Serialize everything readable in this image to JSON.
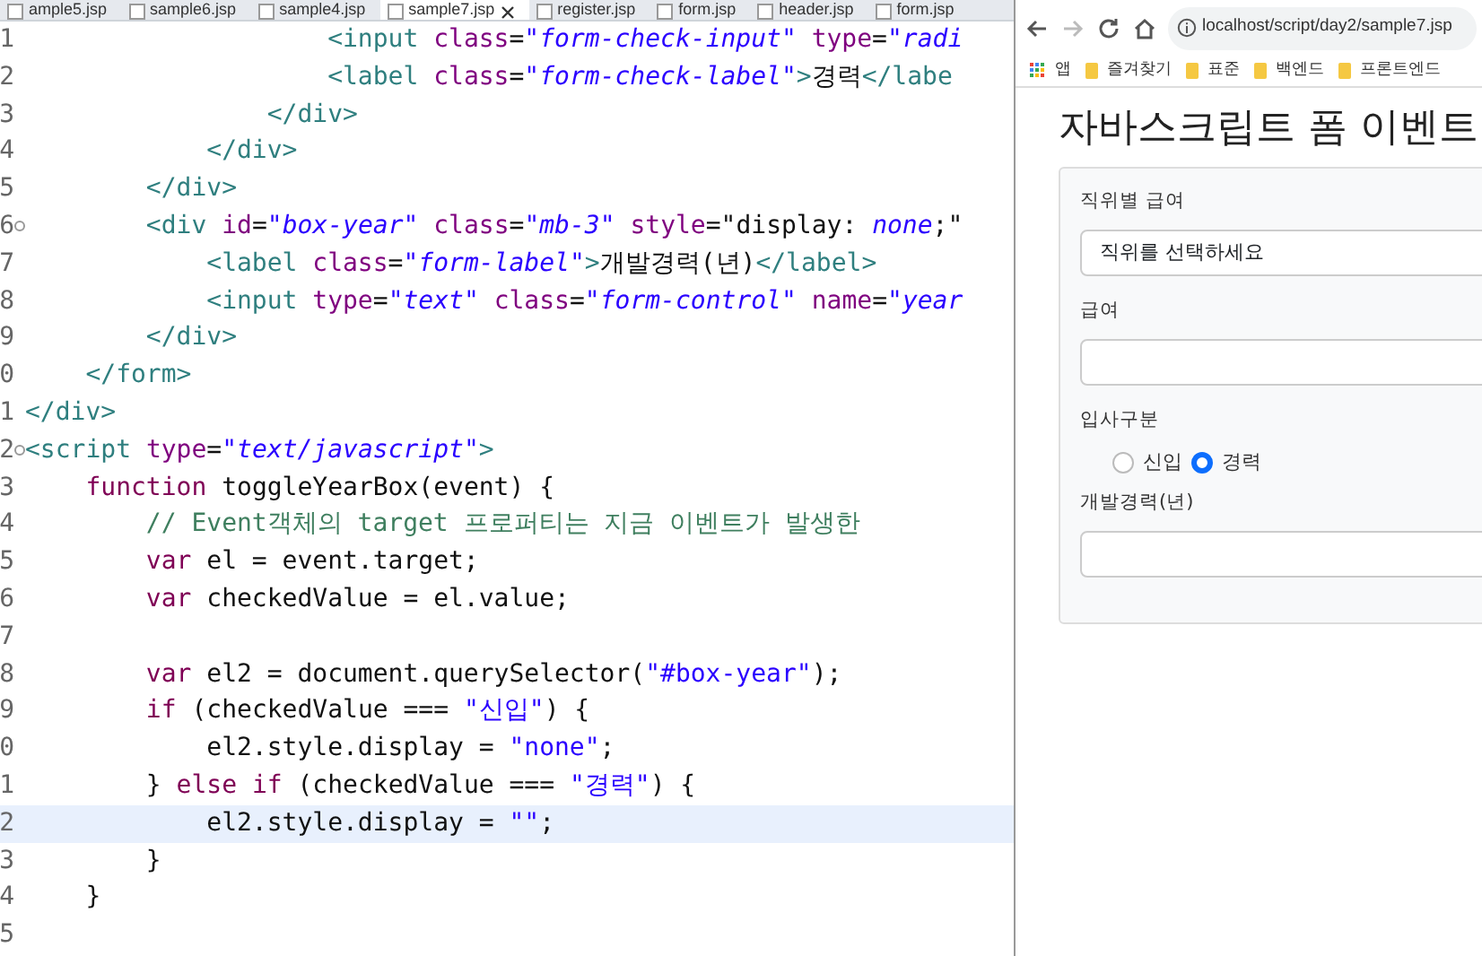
{
  "editor": {
    "tabs": [
      {
        "label": "ample5.jsp",
        "selected": false,
        "closable": false
      },
      {
        "label": "sample6.jsp",
        "selected": false,
        "closable": false
      },
      {
        "label": "sample4.jsp",
        "selected": false,
        "closable": false
      },
      {
        "label": "sample7.jsp",
        "selected": true,
        "closable": true
      },
      {
        "label": "register.jsp",
        "selected": false,
        "closable": false
      },
      {
        "label": "form.jsp",
        "selected": false,
        "closable": false
      },
      {
        "label": "header.jsp",
        "selected": false,
        "closable": false
      },
      {
        "label": "form.jsp",
        "selected": false,
        "closable": false
      }
    ],
    "lines": [
      {
        "num": "1",
        "fold": false,
        "current": false,
        "tokens": [
          {
            "kind": "tag",
            "text": "                    <input"
          },
          {
            "kind": "attr",
            "text": " class"
          },
          {
            "kind": "plain",
            "text": "="
          },
          {
            "kind": "string",
            "text": "\"form-check-input\""
          },
          {
            "kind": "attr",
            "text": " type"
          },
          {
            "kind": "plain",
            "text": "="
          },
          {
            "kind": "string",
            "text": "\"radi"
          }
        ]
      },
      {
        "num": "2",
        "fold": false,
        "current": false,
        "tokens": [
          {
            "kind": "tag",
            "text": "                    <label"
          },
          {
            "kind": "attr",
            "text": " class"
          },
          {
            "kind": "plain",
            "text": "="
          },
          {
            "kind": "string",
            "text": "\"form-check-label\""
          },
          {
            "kind": "tag",
            "text": ">"
          },
          {
            "kind": "plain",
            "text": "경력"
          },
          {
            "kind": "tag",
            "text": "</labe"
          }
        ]
      },
      {
        "num": "3",
        "fold": false,
        "current": false,
        "tokens": [
          {
            "kind": "tag",
            "text": "                </div>"
          }
        ]
      },
      {
        "num": "4",
        "fold": false,
        "current": false,
        "tokens": [
          {
            "kind": "tag",
            "text": "            </div>"
          }
        ]
      },
      {
        "num": "5",
        "fold": false,
        "current": false,
        "tokens": [
          {
            "kind": "tag",
            "text": "        </div>"
          }
        ]
      },
      {
        "num": "6",
        "fold": true,
        "current": false,
        "tokens": [
          {
            "kind": "tag",
            "text": "        <div"
          },
          {
            "kind": "attr",
            "text": " id"
          },
          {
            "kind": "plain",
            "text": "="
          },
          {
            "kind": "string",
            "text": "\"box-year\""
          },
          {
            "kind": "attr",
            "text": " class"
          },
          {
            "kind": "plain",
            "text": "="
          },
          {
            "kind": "string",
            "text": "\"mb-3\""
          },
          {
            "kind": "attr",
            "text": " style"
          },
          {
            "kind": "plain",
            "text": "=\"display: "
          },
          {
            "kind": "string",
            "text": "none"
          },
          {
            "kind": "plain",
            "text": ";\""
          }
        ]
      },
      {
        "num": "7",
        "fold": false,
        "current": false,
        "tokens": [
          {
            "kind": "tag",
            "text": "            <label"
          },
          {
            "kind": "attr",
            "text": " class"
          },
          {
            "kind": "plain",
            "text": "="
          },
          {
            "kind": "string",
            "text": "\"form-label\""
          },
          {
            "kind": "tag",
            "text": ">"
          },
          {
            "kind": "plain",
            "text": "개발경력(년)"
          },
          {
            "kind": "tag",
            "text": "</label>"
          }
        ]
      },
      {
        "num": "8",
        "fold": false,
        "current": false,
        "tokens": [
          {
            "kind": "tag",
            "text": "            <input"
          },
          {
            "kind": "attr",
            "text": " type"
          },
          {
            "kind": "plain",
            "text": "="
          },
          {
            "kind": "string",
            "text": "\"text\""
          },
          {
            "kind": "attr",
            "text": " class"
          },
          {
            "kind": "plain",
            "text": "="
          },
          {
            "kind": "string",
            "text": "\"form-control\""
          },
          {
            "kind": "attr",
            "text": " name"
          },
          {
            "kind": "plain",
            "text": "="
          },
          {
            "kind": "string",
            "text": "\"year"
          }
        ]
      },
      {
        "num": "9",
        "fold": false,
        "current": false,
        "tokens": [
          {
            "kind": "tag",
            "text": "        </div>"
          }
        ]
      },
      {
        "num": "0",
        "fold": false,
        "current": false,
        "tokens": [
          {
            "kind": "tag",
            "text": "    </form>"
          }
        ]
      },
      {
        "num": "1",
        "fold": false,
        "current": false,
        "tokens": [
          {
            "kind": "tag",
            "text": "</div>"
          }
        ]
      },
      {
        "num": "2",
        "fold": true,
        "current": false,
        "tokens": [
          {
            "kind": "tag",
            "text": "<script"
          },
          {
            "kind": "attr",
            "text": " type"
          },
          {
            "kind": "plain",
            "text": "="
          },
          {
            "kind": "string",
            "text": "\"text/javascript\""
          },
          {
            "kind": "tag",
            "text": ">"
          }
        ]
      },
      {
        "num": "3",
        "fold": false,
        "current": false,
        "tokens": [
          {
            "kind": "keyword",
            "text": "    function"
          },
          {
            "kind": "plain",
            "text": " toggleYearBox(event) {"
          }
        ]
      },
      {
        "num": "4",
        "fold": false,
        "current": false,
        "tokens": [
          {
            "kind": "comment",
            "text": "        // Event객체의 target 프로퍼티는 지금 이벤트가 발생한"
          }
        ]
      },
      {
        "num": "5",
        "fold": false,
        "current": false,
        "tokens": [
          {
            "kind": "keyword",
            "text": "        var"
          },
          {
            "kind": "plain",
            "text": " el = event.target;"
          }
        ]
      },
      {
        "num": "6",
        "fold": false,
        "current": false,
        "tokens": [
          {
            "kind": "keyword",
            "text": "        var"
          },
          {
            "kind": "plain",
            "text": " checkedValue = el.value;"
          }
        ]
      },
      {
        "num": "7",
        "fold": false,
        "current": false
      },
      {
        "num": "8",
        "fold": false,
        "current": false,
        "tokens": [
          {
            "kind": "keyword",
            "text": "        var"
          },
          {
            "kind": "plain",
            "text": " el2 = document.querySelector("
          },
          {
            "kind": "jsstring",
            "text": "\"#box-year\""
          },
          {
            "kind": "plain",
            "text": ");"
          }
        ]
      },
      {
        "num": "9",
        "fold": false,
        "current": false,
        "tokens": [
          {
            "kind": "keyword",
            "text": "        if"
          },
          {
            "kind": "plain",
            "text": " (checkedValue === "
          },
          {
            "kind": "jsstring",
            "text": "\"신입\""
          },
          {
            "kind": "plain",
            "text": ") {"
          }
        ]
      },
      {
        "num": "0",
        "fold": false,
        "current": false,
        "tokens": [
          {
            "kind": "plain",
            "text": "            el2.style.display = "
          },
          {
            "kind": "jsstring",
            "text": "\"none\""
          },
          {
            "kind": "plain",
            "text": ";"
          }
        ]
      },
      {
        "num": "1",
        "fold": false,
        "current": false,
        "tokens": [
          {
            "kind": "plain",
            "text": "        } "
          },
          {
            "kind": "keyword",
            "text": "else if"
          },
          {
            "kind": "plain",
            "text": " (checkedValue === "
          },
          {
            "kind": "jsstring",
            "text": "\"경력\""
          },
          {
            "kind": "plain",
            "text": ") {"
          }
        ]
      },
      {
        "num": "2",
        "fold": false,
        "current": true,
        "tokens": [
          {
            "kind": "plain",
            "text": "            el2.style.display = "
          },
          {
            "kind": "jsstring",
            "text": "\"\""
          },
          {
            "kind": "plain",
            "text": ";"
          }
        ]
      },
      {
        "num": "3",
        "fold": false,
        "current": false,
        "tokens": [
          {
            "kind": "plain",
            "text": "        }"
          }
        ]
      },
      {
        "num": "4",
        "fold": false,
        "current": false,
        "tokens": [
          {
            "kind": "plain",
            "text": "    }"
          }
        ]
      },
      {
        "num": "5",
        "fold": false,
        "current": false
      }
    ]
  },
  "browser": {
    "back_enabled": true,
    "forward_enabled": false,
    "address": "localhost/script/day2/sample7.jsp",
    "bookmarks": [
      {
        "kind": "apps",
        "label": "앱"
      },
      {
        "kind": "folder",
        "label": "즐겨찾기"
      },
      {
        "kind": "folder",
        "label": "표준"
      },
      {
        "kind": "folder",
        "label": "백엔드"
      },
      {
        "kind": "folder",
        "label": "프론트엔드"
      }
    ],
    "page": {
      "heading": "자바스크립트 폼 이벤트",
      "fields": [
        {
          "kind": "select",
          "label": "직위별 급여",
          "value": "직위를 선택하세요"
        },
        {
          "kind": "text",
          "label": "급여"
        },
        {
          "kind": "radio",
          "label": "입사구분",
          "options": [
            {
              "label": "신입",
              "selected": false
            },
            {
              "label": "경력",
              "selected": true
            }
          ]
        },
        {
          "kind": "text",
          "label": "개발경력(년)"
        }
      ]
    }
  }
}
